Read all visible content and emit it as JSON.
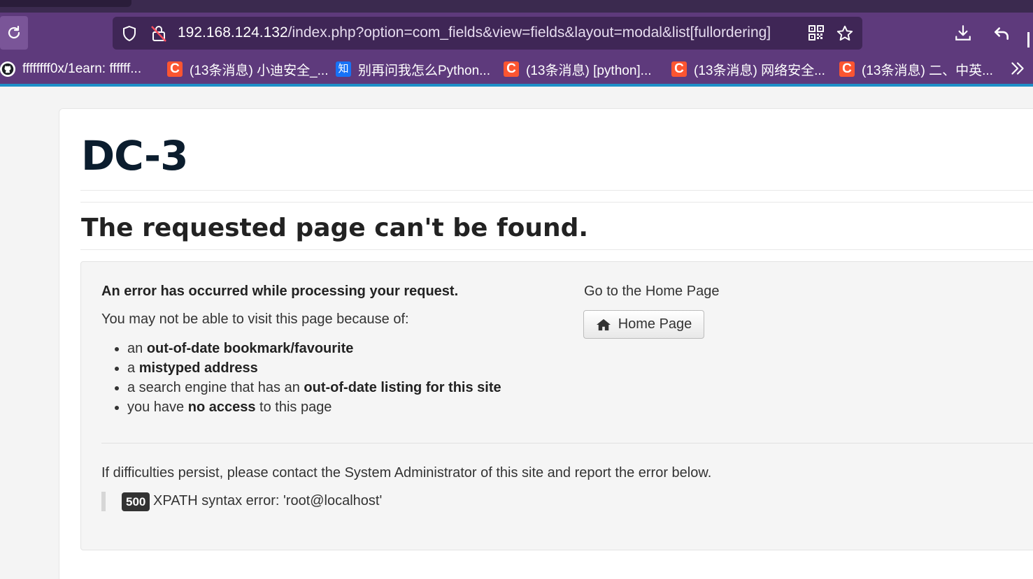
{
  "browser": {
    "url_host": "192.168.124.132",
    "url_path": "/index.php?option=com_fields&view=fields&layout=modal&list[fullordering]",
    "bookmarks": [
      {
        "icon": "github-icon",
        "label": "ffffffff0x/1earn: ffffff..."
      },
      {
        "icon": "csdn-icon",
        "label": "(13条消息) 小迪安全_..."
      },
      {
        "icon": "zhihu-icon",
        "favicon_text": "知",
        "label": "别再问我怎么Python..."
      },
      {
        "icon": "csdn-icon",
        "label": "(13条消息) [python]..."
      },
      {
        "icon": "csdn-icon",
        "label": "(13条消息) 网络安全..."
      },
      {
        "icon": "csdn-icon",
        "label": "(13条消息) 二、中英..."
      }
    ],
    "csdn_favicon_text": "C",
    "colors": {
      "toolbar": "#5e3a7c",
      "urlbar": "#3f2656",
      "accent_line": "#1e90c8"
    }
  },
  "page": {
    "site_title": "DC-3",
    "error_title": "The requested page can't be found.",
    "lead": "An error has occurred while processing your request.",
    "because": "You may not be able to visit this page because of:",
    "reasons": [
      {
        "pre": "an ",
        "bold": "out-of-date bookmark/favourite",
        "post": ""
      },
      {
        "pre": "a ",
        "bold": "mistyped address",
        "post": ""
      },
      {
        "pre": "a search engine that has an ",
        "bold": "out-of-date listing for this site",
        "post": ""
      },
      {
        "pre": "you have ",
        "bold": "no access",
        "post": " to this page"
      }
    ],
    "goto_home": "Go to the Home Page",
    "home_button": "Home Page",
    "contact": "If difficulties persist, please contact the System Administrator of this site and report the error below.",
    "error_code": "500",
    "error_message": "XPATH syntax error: 'root@localhost'"
  }
}
